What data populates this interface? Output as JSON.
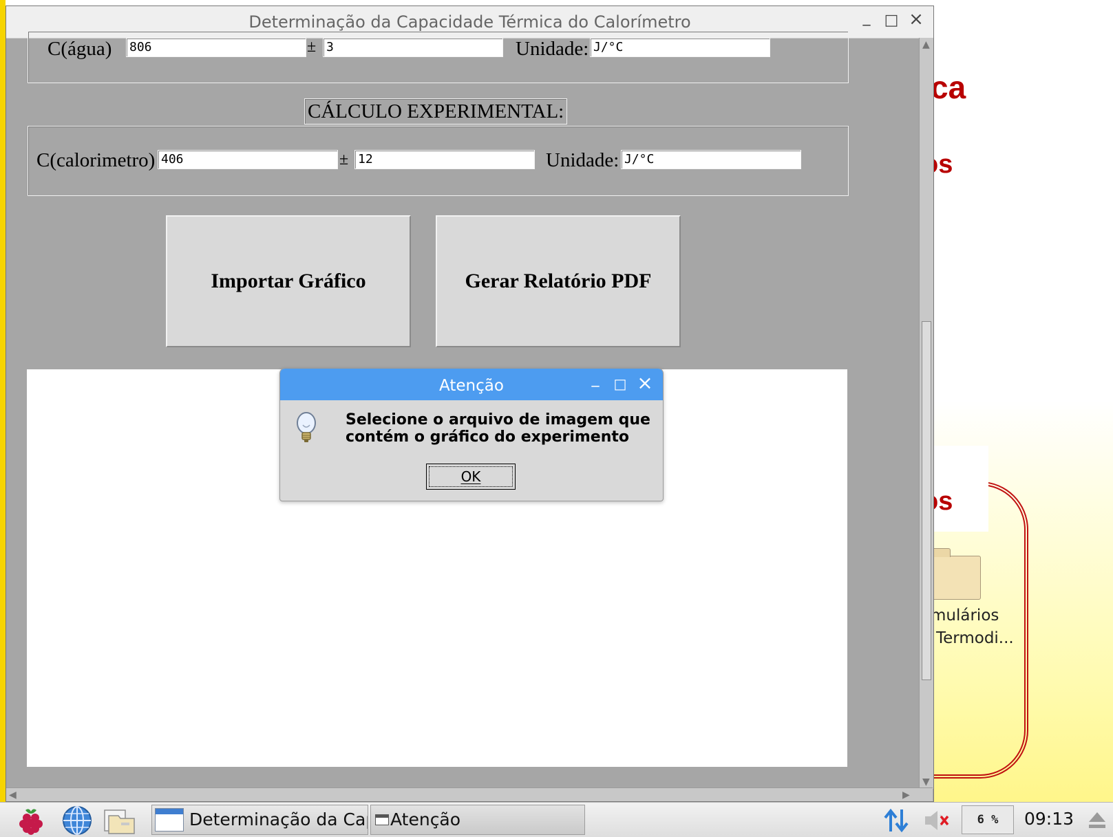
{
  "desktop": {
    "bg_texts": [
      "ca",
      "os",
      "os"
    ],
    "folder_label_line1": "mulários",
    "folder_label_line2": "Termodi..."
  },
  "main_window": {
    "title": "Determinação da Capacidade Térmica do Calorímetro",
    "controls": {
      "minimize": "_",
      "maximize": "□",
      "close": "×"
    },
    "water_row": {
      "label": "C(água)",
      "value": "806",
      "pm": "±",
      "uncertainty": "3",
      "unit_label": "Unidade:",
      "unit_value": "J/°C"
    },
    "experimental": {
      "section_title": "CÁLCULO EXPERIMENTAL:",
      "label": "C(calorimetro)",
      "value": "406",
      "pm": "±",
      "uncertainty": "12",
      "unit_label": "Unidade:",
      "unit_value": "J/°C"
    },
    "buttons": {
      "import_graph": "Importar Gráfico",
      "generate_pdf": "Gerar Relatório PDF"
    }
  },
  "dialog": {
    "title": "Atenção",
    "message": "Selecione o arquivo de imagem que contém o gráfico do experimento",
    "ok_label": "OK",
    "controls": {
      "minimize": "_",
      "maximize": "□",
      "close": "×"
    }
  },
  "taskbar": {
    "items": [
      "Determinação da Cap...",
      "Atenção"
    ],
    "cpu_usage": "6 %",
    "clock": "09:13"
  },
  "colors": {
    "dialog_titlebar": "#4d9cf0",
    "window_background": "#a6a6a6",
    "desktop_accent": "#b80000"
  }
}
